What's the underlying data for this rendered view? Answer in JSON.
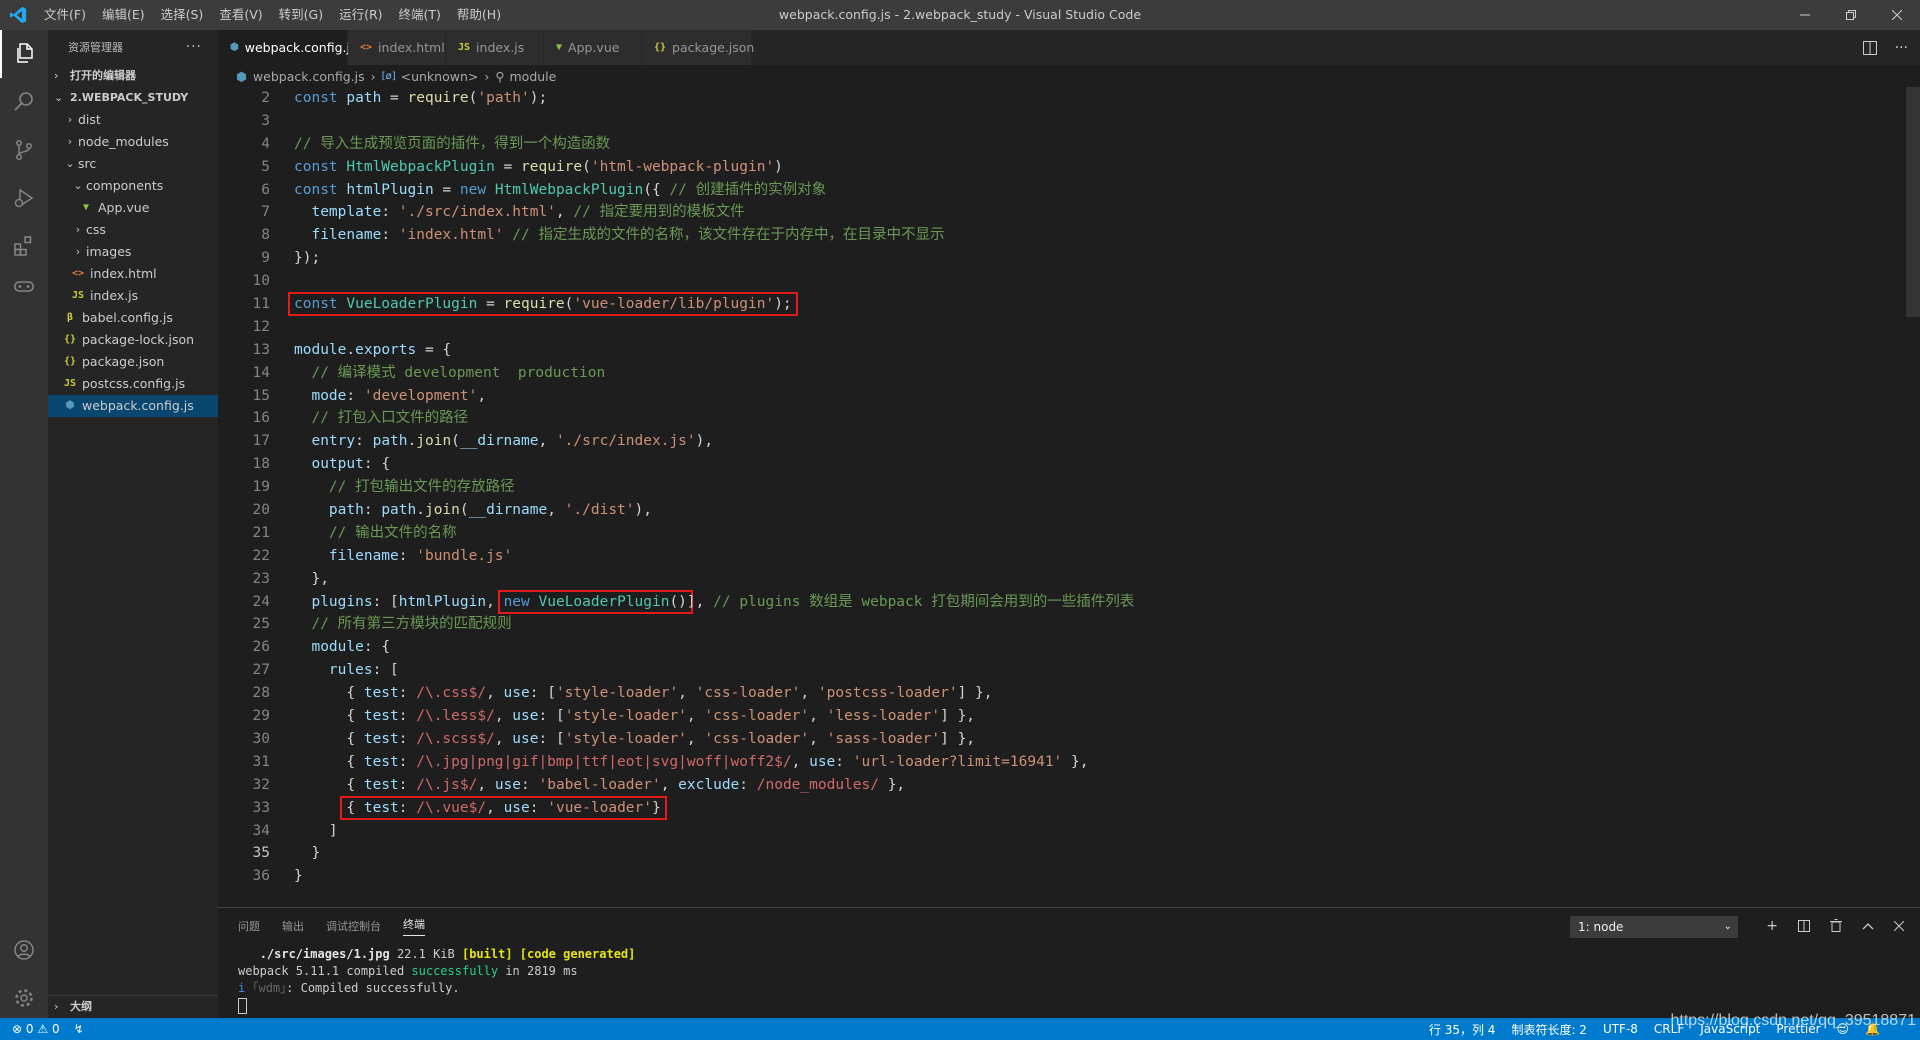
{
  "window": {
    "title": "webpack.config.js - 2.webpack_study - Visual Studio Code",
    "menu": [
      "文件(F)",
      "编辑(E)",
      "选择(S)",
      "查看(V)",
      "转到(G)",
      "运行(R)",
      "终端(T)",
      "帮助(H)"
    ],
    "controls": [
      "minimize",
      "restore",
      "close"
    ]
  },
  "activity_bar": {
    "icons": [
      "files-icon",
      "search-icon",
      "source-control-icon",
      "run-debug-icon",
      "extensions-icon",
      "remote-icon",
      "account-icon",
      "settings-gear-icon"
    ],
    "active": "files-icon"
  },
  "sidebar": {
    "title": "资源管理器",
    "more": "···",
    "open_editors_label": "打开的编辑器",
    "project_label": "2.WEBPACK_STUDY",
    "tree": [
      {
        "label": "dist",
        "kind": "folder",
        "expanded": false,
        "depth": 1
      },
      {
        "label": "node_modules",
        "kind": "folder",
        "expanded": false,
        "depth": 1
      },
      {
        "label": "src",
        "kind": "folder",
        "expanded": true,
        "depth": 1
      },
      {
        "label": "components",
        "kind": "folder",
        "expanded": true,
        "depth": 2
      },
      {
        "label": "App.vue",
        "kind": "vue",
        "depth": 3
      },
      {
        "label": "css",
        "kind": "folder",
        "expanded": false,
        "depth": 2
      },
      {
        "label": "images",
        "kind": "folder",
        "expanded": false,
        "depth": 2
      },
      {
        "label": "index.html",
        "kind": "html",
        "depth": 2
      },
      {
        "label": "index.js",
        "kind": "js",
        "depth": 2
      },
      {
        "label": "babel.config.js",
        "kind": "babel",
        "depth": 1
      },
      {
        "label": "package-lock.json",
        "kind": "json",
        "depth": 1
      },
      {
        "label": "package.json",
        "kind": "json",
        "depth": 1
      },
      {
        "label": "postcss.config.js",
        "kind": "js",
        "depth": 1
      },
      {
        "label": "webpack.config.js",
        "kind": "webpack",
        "depth": 1,
        "selected": true
      }
    ],
    "outline_label": "大纲"
  },
  "tabs": [
    {
      "label": "webpack.config.js",
      "kind": "webpack",
      "active": true,
      "close": "×"
    },
    {
      "label": "index.html",
      "kind": "html"
    },
    {
      "label": "index.js",
      "kind": "js"
    },
    {
      "label": "App.vue",
      "kind": "vue"
    },
    {
      "label": "package.json",
      "kind": "json"
    }
  ],
  "breadcrumb": {
    "file": "webpack.config.js",
    "scope": "<unknown>",
    "symbol": "module"
  },
  "editor": {
    "current_line": 35,
    "lines": [
      {
        "n": "2",
        "code": "const path = require('path');"
      },
      {
        "n": "3",
        "code": ""
      },
      {
        "n": "4",
        "code": "// 导入生成预览页面的插件，得到一个构造函数"
      },
      {
        "n": "5",
        "code": "const HtmlWebpackPlugin = require('html-webpack-plugin')"
      },
      {
        "n": "6",
        "code": "const htmlPlugin = new HtmlWebpackPlugin({ // 创建插件的实例对象"
      },
      {
        "n": "7",
        "code": "  template: './src/index.html', // 指定要用到的模板文件"
      },
      {
        "n": "8",
        "code": "  filename: 'index.html' // 指定生成的文件的名称，该文件存在于内存中，在目录中不显示"
      },
      {
        "n": "9",
        "code": "});"
      },
      {
        "n": "10",
        "code": ""
      },
      {
        "n": "11",
        "code": "const VueLoaderPlugin = require('vue-loader/lib/plugin');"
      },
      {
        "n": "12",
        "code": ""
      },
      {
        "n": "13",
        "code": "module.exports = {"
      },
      {
        "n": "14",
        "code": "  // 编译模式 development  production"
      },
      {
        "n": "15",
        "code": "  mode: 'development',"
      },
      {
        "n": "16",
        "code": "  // 打包入口文件的路径"
      },
      {
        "n": "17",
        "code": "  entry: path.join(__dirname, './src/index.js'),"
      },
      {
        "n": "18",
        "code": "  output: {"
      },
      {
        "n": "19",
        "code": "    // 打包输出文件的存放路径"
      },
      {
        "n": "20",
        "code": "    path: path.join(__dirname, './dist'),"
      },
      {
        "n": "21",
        "code": "    // 输出文件的名称"
      },
      {
        "n": "22",
        "code": "    filename: 'bundle.js'"
      },
      {
        "n": "23",
        "code": "  },"
      },
      {
        "n": "24",
        "code": "  plugins: [htmlPlugin, new VueLoaderPlugin()], // plugins 数组是 webpack 打包期间会用到的一些插件列表"
      },
      {
        "n": "25",
        "code": "  // 所有第三方模块的匹配规则"
      },
      {
        "n": "26",
        "code": "  module: {"
      },
      {
        "n": "27",
        "code": "    rules: ["
      },
      {
        "n": "28",
        "code": "      { test: /\\.css$/, use: ['style-loader', 'css-loader', 'postcss-loader'] },"
      },
      {
        "n": "29",
        "code": "      { test: /\\.less$/, use: ['style-loader', 'css-loader', 'less-loader'] },"
      },
      {
        "n": "30",
        "code": "      { test: /\\.scss$/, use: ['style-loader', 'css-loader', 'sass-loader'] },"
      },
      {
        "n": "31",
        "code": "      { test: /\\.jpg|png|gif|bmp|ttf|eot|svg|woff|woff2$/, use: 'url-loader?limit=16941' },"
      },
      {
        "n": "32",
        "code": "      { test: /\\.js$/, use: 'babel-loader', exclude: /node_modules/ },"
      },
      {
        "n": "33",
        "code": "      { test: /\\.vue$/, use: 'vue-loader'}"
      },
      {
        "n": "34",
        "code": "    ]"
      },
      {
        "n": "35",
        "code": "  }"
      },
      {
        "n": "36",
        "code": "}"
      }
    ]
  },
  "panel": {
    "tabs": [
      "问题",
      "输出",
      "调试控制台",
      "终端"
    ],
    "active_tab": "终端",
    "terminal_select": "1: node",
    "terminal_lines": [
      {
        "text": "   ./src/images/1.jpg 22.1 KiB [built] [code generated]"
      },
      {
        "text": "webpack 5.11.1 compiled successfully in 2819 ms"
      },
      {
        "text": "i ｢wdm｣: Compiled successfully."
      }
    ]
  },
  "statusbar": {
    "errors": "0",
    "warnings": "0",
    "position": "行 35，列 4",
    "indent": "制表符长度: 2",
    "encoding": "UTF-8",
    "eol": "CRLF",
    "language": "JavaScript",
    "formatter": "Prettier",
    "watermark": "https://blog.csdn.net/qq_39518871"
  },
  "colors": {
    "accent": "#007acc",
    "highlight_box": "#e3191c",
    "selection": "#094771"
  }
}
